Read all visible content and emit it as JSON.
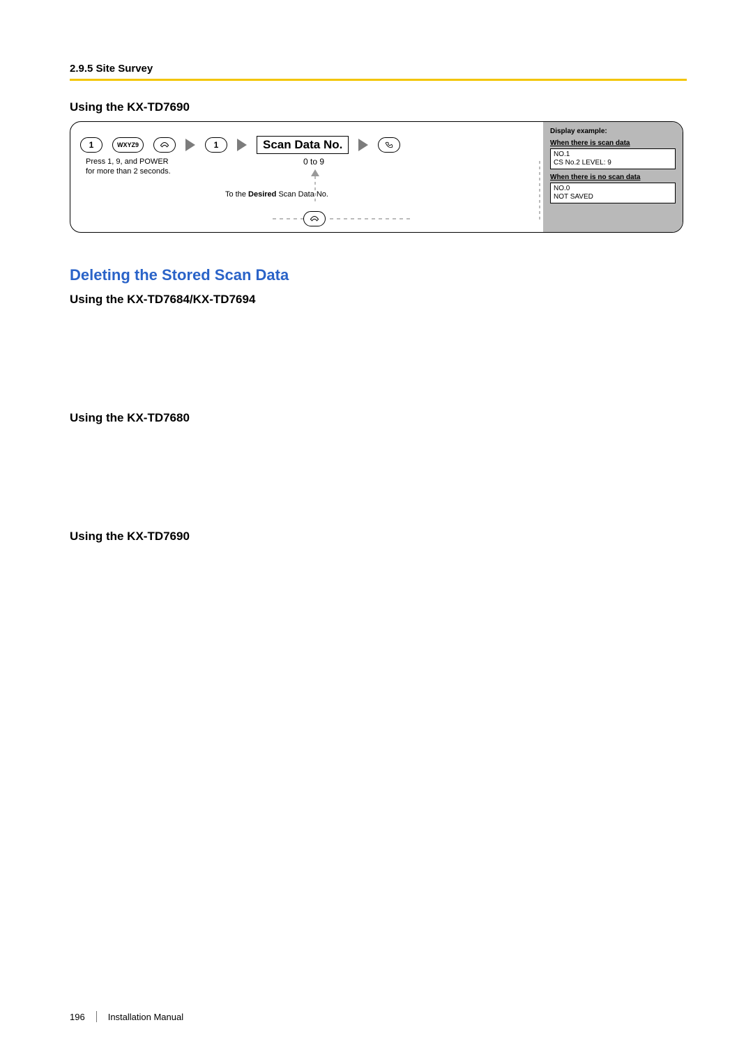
{
  "header": {
    "section": "2.9.5 Site Survey"
  },
  "subheads": {
    "a": "Using the KX-TD7690",
    "b": "Using the KX-TD7684/KX-TD7694",
    "c": "Using the KX-TD7680",
    "d": "Using the KX-TD7690"
  },
  "section_title": "Deleting the Stored Scan Data",
  "diagram": {
    "btn1": "1",
    "btn9": "WXYZ9",
    "press_text_l1": "Press 1, 9, and POWER",
    "press_text_l2": "for more than 2 seconds.",
    "scan_label": "Scan Data No.",
    "zero_to_nine": "0 to 9",
    "desired_prefix": "To the ",
    "desired_bold": "Desired",
    "desired_suffix": " Scan Data No.",
    "display": {
      "title": "Display example:",
      "sub1": "When there is scan data",
      "box1_l1": "NO.1",
      "box1_l2": "CS No.2 LEVEL: 9",
      "sub2": "When there is no scan data",
      "box2_l1": "NO.0",
      "box2_l2": "NOT SAVED"
    }
  },
  "footer": {
    "page": "196",
    "title": "Installation Manual"
  }
}
